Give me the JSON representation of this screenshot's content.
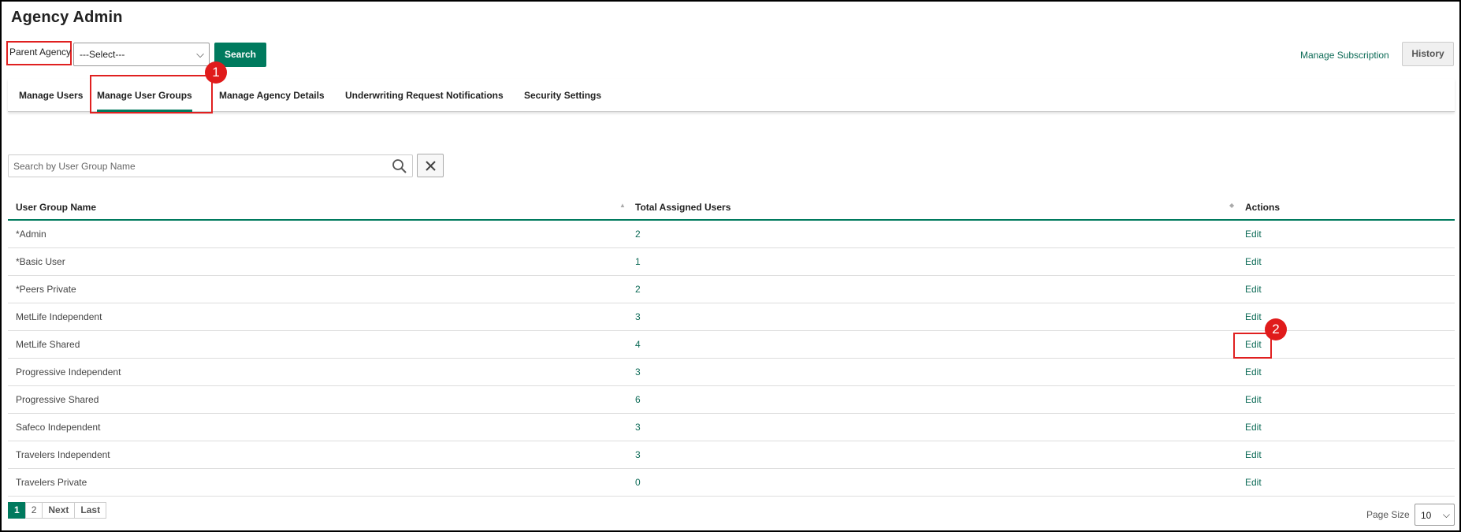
{
  "app": {
    "title": "Agency Admin"
  },
  "filter": {
    "parent_label": "Parent Agency",
    "select_value": "---Select---",
    "search_button": "Search"
  },
  "header_links": {
    "manage_subscription": "Manage Subscription",
    "history": "History"
  },
  "tabs": [
    {
      "label": "Manage Users",
      "active": false
    },
    {
      "label": "Manage User Groups",
      "active": true
    },
    {
      "label": "Manage Agency Details",
      "active": false
    },
    {
      "label": "Underwriting Request Notifications",
      "active": false
    },
    {
      "label": "Security Settings",
      "active": false
    }
  ],
  "search": {
    "placeholder": "Search by User Group Name"
  },
  "table": {
    "columns": [
      "User Group Name",
      "Total Assigned Users",
      "Actions"
    ],
    "rows": [
      {
        "name": "*Admin",
        "count": "2",
        "action": "Edit"
      },
      {
        "name": "*Basic User",
        "count": "1",
        "action": "Edit"
      },
      {
        "name": "*Peers Private",
        "count": "2",
        "action": "Edit"
      },
      {
        "name": "MetLife Independent",
        "count": "3",
        "action": "Edit"
      },
      {
        "name": "MetLife Shared",
        "count": "4",
        "action": "Edit"
      },
      {
        "name": "Progressive Independent",
        "count": "3",
        "action": "Edit"
      },
      {
        "name": "Progressive Shared",
        "count": "6",
        "action": "Edit"
      },
      {
        "name": "Safeco Independent",
        "count": "3",
        "action": "Edit"
      },
      {
        "name": "Travelers Independent",
        "count": "3",
        "action": "Edit"
      },
      {
        "name": "Travelers Private",
        "count": "0",
        "action": "Edit"
      }
    ]
  },
  "pager": {
    "pages": [
      "1",
      "2"
    ],
    "next": "Next",
    "last": "Last"
  },
  "page_size": {
    "label": "Page Size",
    "value": "10"
  },
  "annotations": {
    "marker_1": "1",
    "marker_2": "2"
  },
  "colors": {
    "accent": "#007a5e",
    "link": "#0d6b57",
    "highlight": "#e02020"
  }
}
